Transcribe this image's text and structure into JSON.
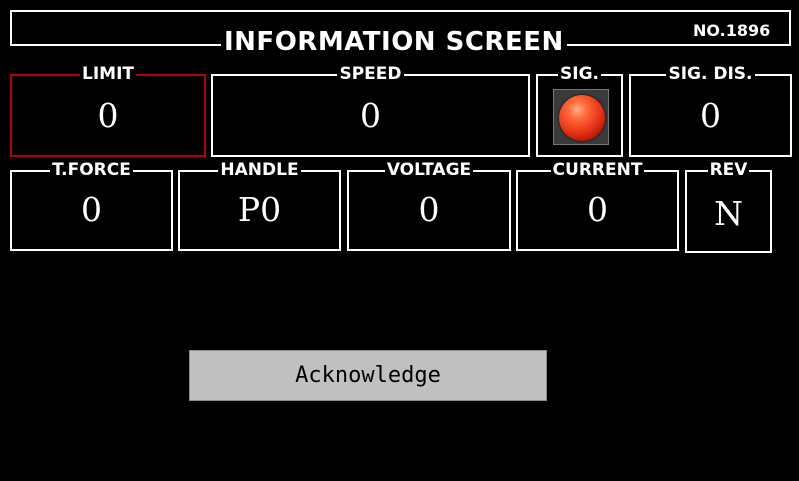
{
  "header": {
    "title": "INFORMATION SCREEN",
    "number": "NO.1896"
  },
  "row1": {
    "limit": {
      "label": "LIMIT",
      "value": "0",
      "border_color": "#b00000"
    },
    "speed": {
      "label": "SPEED",
      "value": "0"
    },
    "signal": {
      "label": "SIG.",
      "lamp_color": "#e8341a",
      "lamp_state": "red"
    },
    "signal_distance": {
      "label": "SIG. DIS.",
      "value": "0"
    }
  },
  "row2": {
    "tractive_force": {
      "label": "T.FORCE",
      "value": "0"
    },
    "handle": {
      "label": "HANDLE",
      "value": "P0"
    },
    "voltage": {
      "label": "VOLTAGE",
      "value": "0"
    },
    "current": {
      "label": "CURRENT",
      "value": "0"
    },
    "reverser": {
      "label": "REV",
      "value": "N"
    }
  },
  "actions": {
    "acknowledge_label": "Acknowledge"
  }
}
